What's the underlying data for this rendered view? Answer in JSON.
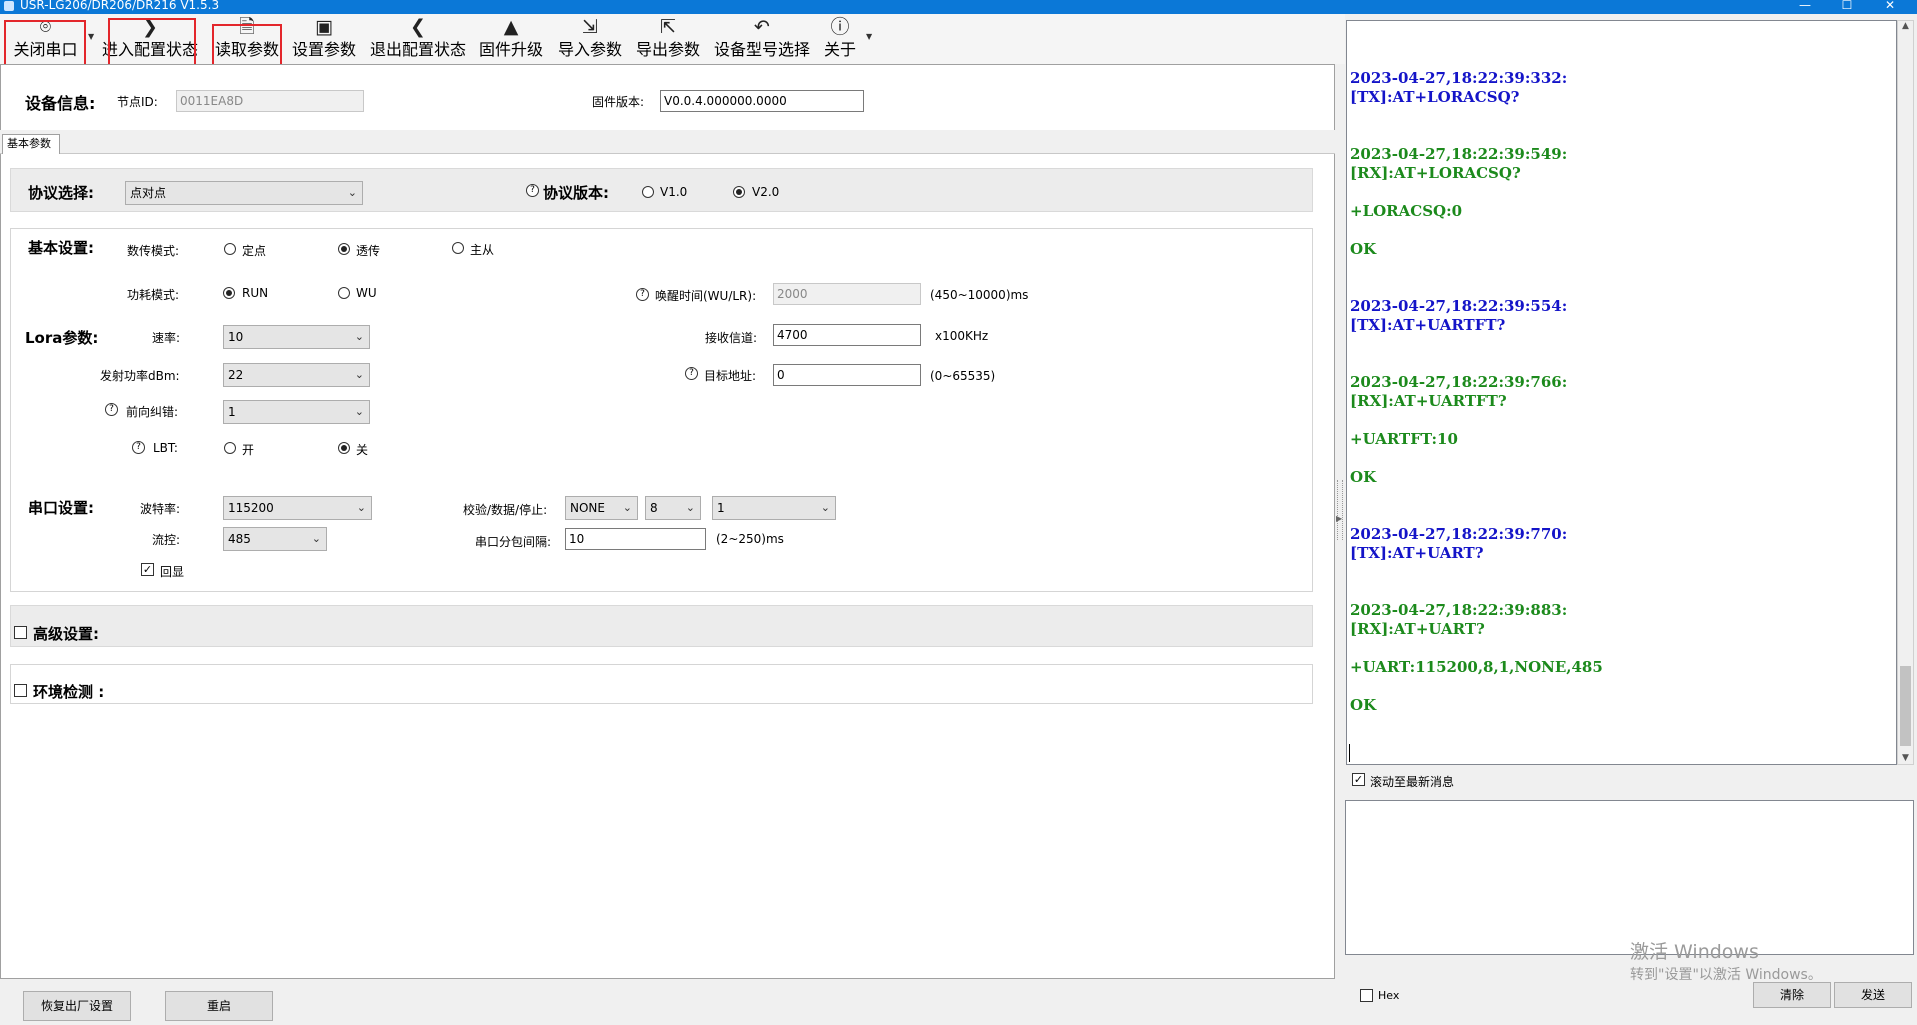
{
  "window": {
    "title": "USR-LG206/DR206/DR216 V1.5.3",
    "minimize": "—",
    "maximize": "☐",
    "close": "✕"
  },
  "toolbar": {
    "close_port": "关闭串口",
    "enter_config": "进入配置状态",
    "read_params": "读取参数",
    "set_params": "设置参数",
    "exit_config": "退出配置状态",
    "firmware_upgrade": "固件升级",
    "import_params": "导入参数",
    "export_params": "导出参数",
    "device_model": "设备型号选择",
    "about": "关于"
  },
  "device_info": {
    "header": "设备信息:",
    "node_id_label": "节点ID:",
    "node_id": "0011EA8D",
    "firmware_label": "固件版本:",
    "firmware": "V0.0.4.000000.0000"
  },
  "tabs": {
    "basic": "基本参数"
  },
  "protocol": {
    "select_label": "协议选择:",
    "select_value": "点对点",
    "version_label": "协议版本:",
    "v1": "V1.0",
    "v2": "V2.0",
    "selected": "V2.0"
  },
  "basic": {
    "header": "基本设置:",
    "mode_label": "数传模式:",
    "mode_fixed": "定点",
    "mode_transparent": "透传",
    "mode_master": "主从",
    "power_label": "功耗模式:",
    "power_run": "RUN",
    "power_wu": "WU",
    "wake_label": "唤醒时间(WU/LR):",
    "wake_value": "2000",
    "wake_range": "(450~10000)ms"
  },
  "lora": {
    "header": "Lora参数:",
    "rate_label": "速率:",
    "rate_value": "10",
    "channel_label": "接收信道:",
    "channel_value": "4700",
    "channel_unit": "x100KHz",
    "tx_power_label": "发射功率dBm:",
    "tx_power_value": "22",
    "target_label": "目标地址:",
    "target_value": "0",
    "target_range": "(0~65535)",
    "fec_label": "前向纠错:",
    "fec_value": "1",
    "lbt_label": "LBT:",
    "lbt_on": "开",
    "lbt_off": "关"
  },
  "serial": {
    "header": "串口设置:",
    "baud_label": "波特率:",
    "baud_value": "115200",
    "parity_label": "校验/数据/停止:",
    "parity_value": "NONE",
    "data_value": "8",
    "stop_value": "1",
    "flow_label": "流控:",
    "flow_value": "485",
    "packet_label": "串口分包间隔:",
    "packet_value": "10",
    "packet_range": "(2~250)ms",
    "echo_label": "回显"
  },
  "advanced": {
    "label": "高级设置:"
  },
  "env": {
    "label": "环境检测 :"
  },
  "bottom": {
    "factory_reset": "恢复出厂设置",
    "restart": "重启"
  },
  "log": [
    {
      "text": "2023-04-27,18:22:39:332:",
      "kind": "tx"
    },
    {
      "text": "[TX]:AT+LORACSQ?",
      "kind": "tx"
    },
    {
      "text": "2023-04-27,18:22:39:549:",
      "kind": "rx"
    },
    {
      "text": "[RX]:AT+LORACSQ?",
      "kind": "rx"
    },
    {
      "text": "+LORACSQ:0",
      "kind": "rx"
    },
    {
      "text": "OK",
      "kind": "rx"
    },
    {
      "text": "2023-04-27,18:22:39:554:",
      "kind": "tx"
    },
    {
      "text": "[TX]:AT+UARTFT?",
      "kind": "tx"
    },
    {
      "text": "2023-04-27,18:22:39:766:",
      "kind": "rx"
    },
    {
      "text": "[RX]:AT+UARTFT?",
      "kind": "rx"
    },
    {
      "text": "+UARTFT:10",
      "kind": "rx"
    },
    {
      "text": "OK",
      "kind": "rx"
    },
    {
      "text": "2023-04-27,18:22:39:770:",
      "kind": "tx"
    },
    {
      "text": "[TX]:AT+UART?",
      "kind": "tx"
    },
    {
      "text": "2023-04-27,18:22:39:883:",
      "kind": "rx"
    },
    {
      "text": "[RX]:AT+UART?",
      "kind": "rx"
    },
    {
      "text": "+UART:115200,8,1,NONE,485",
      "kind": "rx"
    },
    {
      "text": "OK",
      "kind": "rx"
    }
  ],
  "log_colors": {
    "tx": "#1414c8",
    "rx": "#1c8a1c"
  },
  "right": {
    "autoscroll": "滚动至最新消息",
    "hex": "Hex",
    "clear": "清除",
    "send": "发送",
    "watermark1": "激活 Windows",
    "watermark2": "转到\"设置\"以激活 Windows。"
  }
}
